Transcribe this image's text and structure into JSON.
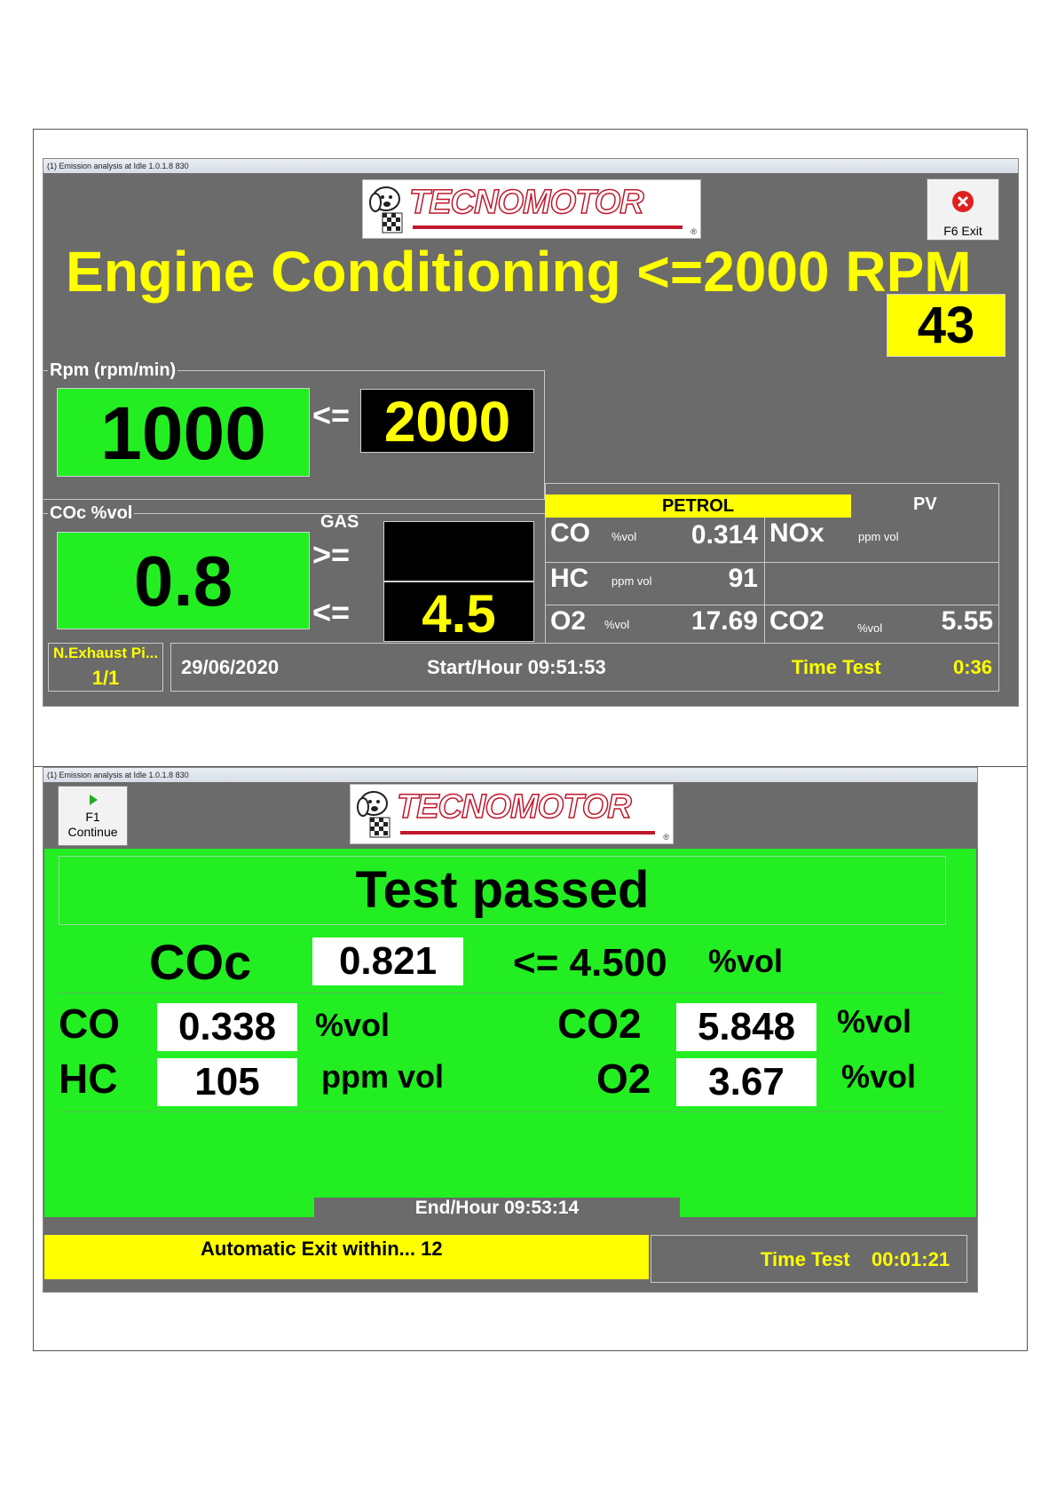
{
  "screen1": {
    "window_title": "(1) Emission analysis at Idle 1.0.1.8  830",
    "logo_text": "TECNOMOTOR",
    "logo_reg": "®",
    "exit_button": {
      "key": "F6",
      "label": "F6 Exit"
    },
    "heading": "Engine Conditioning <=2000 RPM",
    "countdown": "43",
    "rpm": {
      "legend": "Rpm (rpm/min)",
      "value": "1000",
      "operator": "<=",
      "limit": "2000"
    },
    "coc": {
      "legend": "COc %vol",
      "gas_label": "GAS",
      "ge_operator": ">=",
      "le_operator": "<=",
      "value": "0.8",
      "upper_limit": "4.5",
      "lower_limit": ""
    },
    "fuel_label": "PETROL",
    "pv_label": "PV",
    "gases": [
      {
        "name": "CO",
        "unit": "%vol",
        "value": "0.314"
      },
      {
        "name": "NOx",
        "unit": "ppm vol",
        "value": ""
      },
      {
        "name": "HC",
        "unit": "ppm vol",
        "value": "91"
      },
      {
        "name": "O2",
        "unit": "%vol",
        "value": "17.69"
      },
      {
        "name": "CO2",
        "unit": "%vol",
        "value": "5.55"
      }
    ],
    "status": {
      "n_exhaust_label": "N.Exhaust Pi...",
      "n_exhaust_value": "1/1",
      "date": "29/06/2020",
      "start_hour": "Start/Hour 09:51:53",
      "time_test_label": "Time Test",
      "time_test_value": "0:36"
    }
  },
  "screen2": {
    "window_title": "(1) Emission analysis at Idle 1.0.1.8  830",
    "logo_text": "TECNOMOTOR",
    "logo_reg": "®",
    "continue_button": {
      "key": "F1",
      "label": "Continue"
    },
    "result": "Test passed",
    "coc": {
      "name": "COc",
      "value": "0.821",
      "limit": "<= 4.500",
      "unit": "%vol"
    },
    "gases_left": [
      {
        "name": "CO",
        "value": "0.338",
        "unit": "%vol"
      },
      {
        "name": "HC",
        "value": "105",
        "unit": "ppm vol"
      }
    ],
    "gases_right": [
      {
        "name": "CO2",
        "value": "5.848",
        "unit": "%vol"
      },
      {
        "name": "O2",
        "value": "3.67",
        "unit": "%vol"
      }
    ],
    "end_hour": "End/Hour 09:53:14",
    "auto_exit": "Automatic Exit within... 12",
    "time_test_label": "Time Test",
    "time_test_value": "00:01:21"
  },
  "colors": {
    "panel_grey": "#6b6b6b",
    "led_green": "#22ee22",
    "accent_yellow": "#ffff00",
    "logo_red": "#c0182c"
  }
}
